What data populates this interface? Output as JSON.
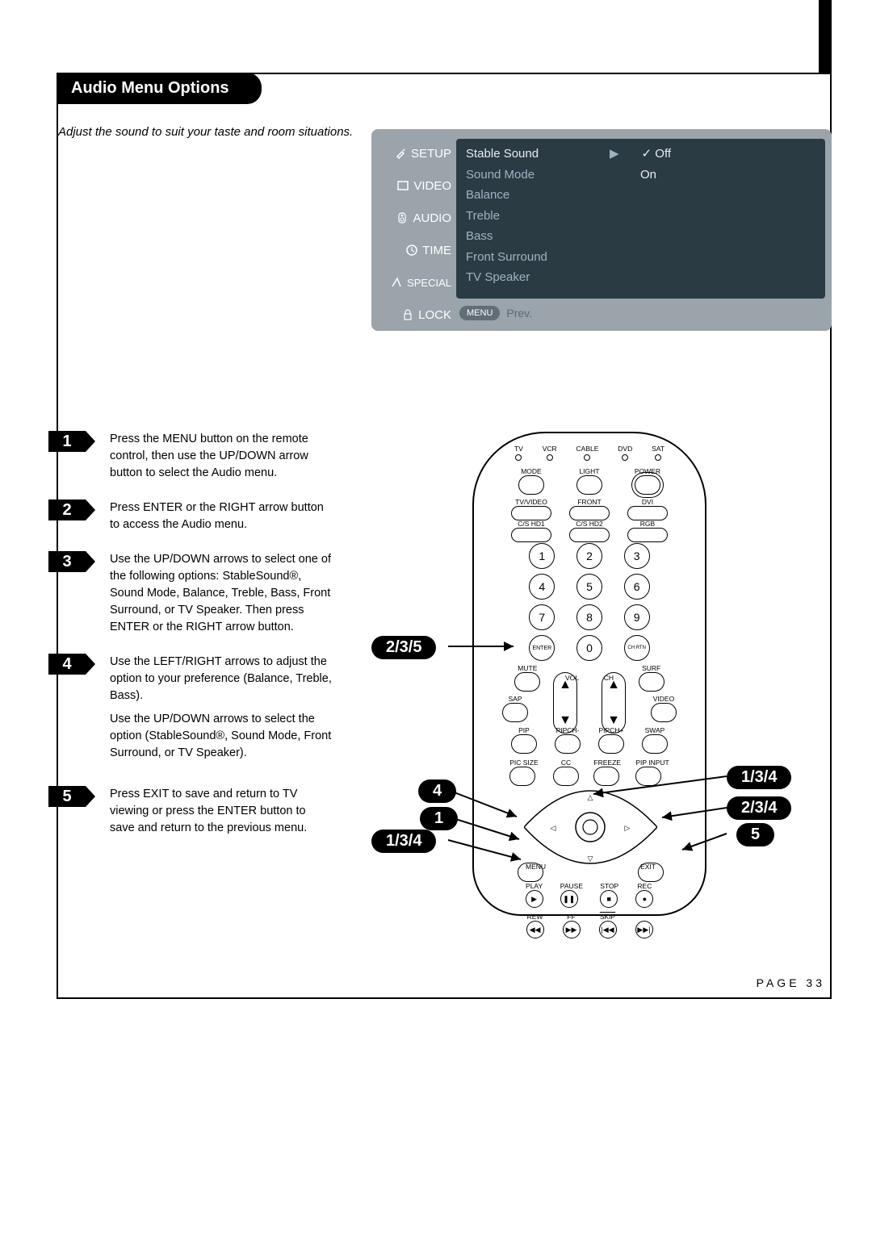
{
  "ribbon": "Audio Menu Options",
  "intro": "Adjust the sound to suit your taste and room situations.",
  "menu": {
    "tabs": [
      "SETUP",
      "VIDEO",
      "AUDIO",
      "TIME",
      "SPECIAL",
      "LOCK"
    ],
    "items": [
      {
        "label": "Stable Sound",
        "selected": true,
        "arrow": "▶",
        "value": "✓ Off"
      },
      {
        "label": "Sound Mode",
        "value": "On"
      },
      {
        "label": "Balance"
      },
      {
        "label": "Treble"
      },
      {
        "label": "Bass"
      },
      {
        "label": "Front Surround"
      },
      {
        "label": "TV Speaker"
      }
    ],
    "footer_pill": "MENU",
    "footer_text": "Prev."
  },
  "steps": [
    {
      "n": "1",
      "p": [
        "Press the MENU button on the remote control, then use the UP/DOWN arrow button to select the Audio menu."
      ]
    },
    {
      "n": "2",
      "p": [
        "Press ENTER or the RIGHT arrow button to access the Audio menu."
      ]
    },
    {
      "n": "3",
      "p": [
        "Use the UP/DOWN arrows to select one of the following options: StableSound®, Sound Mode, Balance, Treble, Bass, Front Surround, or TV Speaker. Then press ENTER or the RIGHT arrow button."
      ]
    },
    {
      "n": "4",
      "p": [
        "Use the LEFT/RIGHT arrows to adjust the option to your preference (Balance, Treble, Bass).",
        "Use the UP/DOWN arrows to select the option (StableSound®, Sound Mode, Front Surround, or TV Speaker)."
      ]
    },
    {
      "n": "5",
      "p": [
        "Press EXIT to save and return to TV viewing or press the ENTER button to save and return to the previous menu."
      ]
    }
  ],
  "remote": {
    "leds": [
      "TV",
      "VCR",
      "CABLE",
      "DVD",
      "SAT"
    ],
    "row1": [
      "MODE",
      "LIGHT",
      "POWER"
    ],
    "row2": [
      "TV/VIDEO",
      "FRONT",
      "DVI"
    ],
    "row3": [
      "C/S HD1",
      "C/S HD2",
      "RGB"
    ],
    "nums": [
      "1",
      "2",
      "3",
      "4",
      "5",
      "6",
      "7",
      "8",
      "9"
    ],
    "enter": "ENTER",
    "zero": "0",
    "chrtn": "CH RTN",
    "mute": "MUTE",
    "vol": "VOL",
    "ch": "CH",
    "surf": "SURF",
    "sap": "SAP",
    "video": "VIDEO",
    "pip": "PIP",
    "pipchm": "PIPCH-",
    "pipchp": "PIPCH+",
    "swap": "SWAP",
    "picsize": "PIC SIZE",
    "cc": "CC",
    "freeze": "FREEZE",
    "pipinput": "PIP INPUT",
    "menu": "MENU",
    "exit": "EXIT",
    "play": "PLAY",
    "pause": "PAUSE",
    "stop": "STOP",
    "rec": "REC",
    "rew": "REW",
    "ff": "FF",
    "skip": "SKIP"
  },
  "callouts": {
    "c1": "2/3/5",
    "c2": "4",
    "c3": "1",
    "c4": "1/3/4",
    "c5": "1/3/4",
    "c6": "2/3/4",
    "c7": "5"
  },
  "page": "PAGE 33"
}
